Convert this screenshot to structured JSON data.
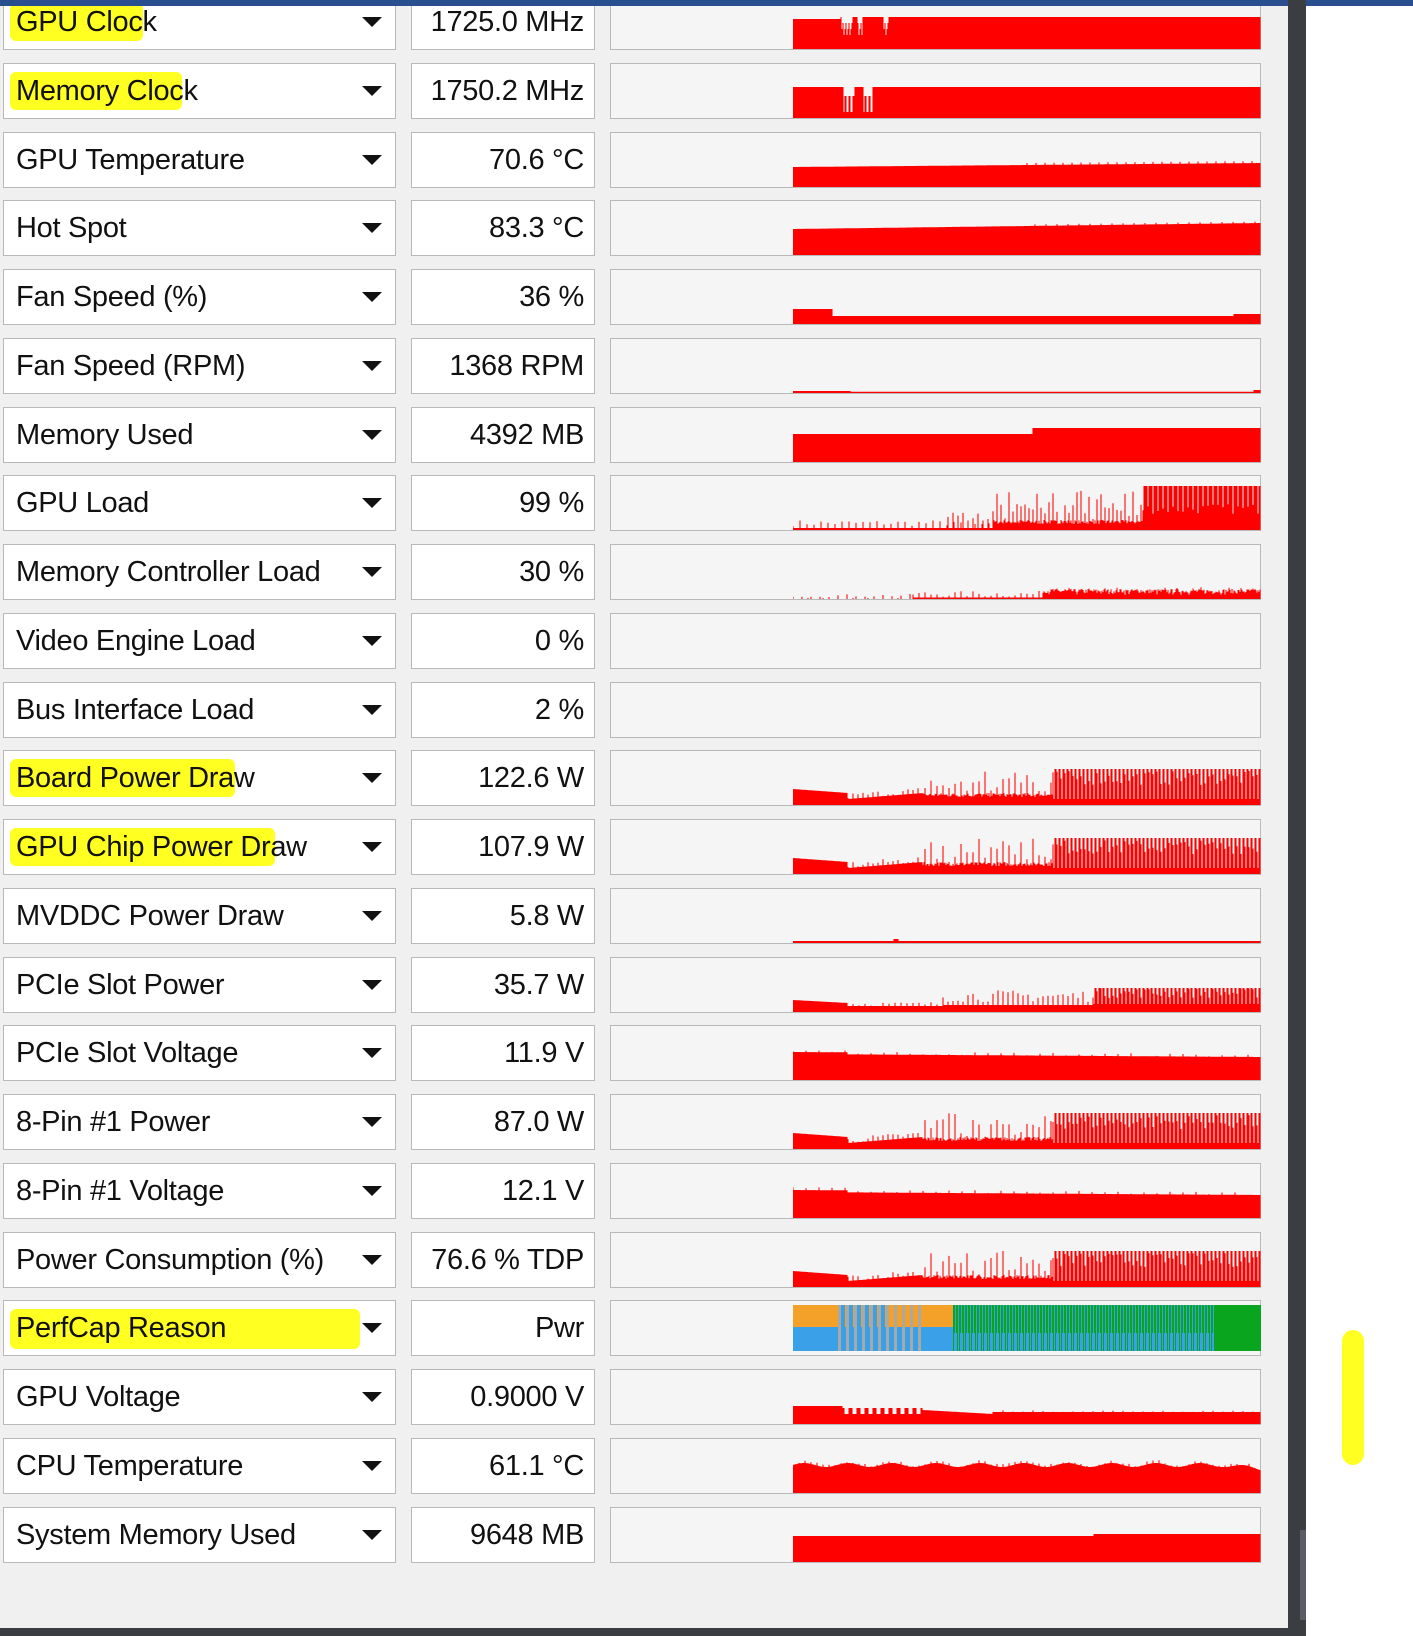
{
  "sensors": [
    {
      "name": "GPU Clock",
      "value": "1725.0 MHz",
      "highlighted": true,
      "graph": "clock"
    },
    {
      "name": "Memory Clock",
      "value": "1750.2 MHz",
      "highlighted": true,
      "graph": "memclock"
    },
    {
      "name": "GPU Temperature",
      "value": "70.6 °C",
      "highlighted": false,
      "graph": "temp"
    },
    {
      "name": "Hot Spot",
      "value": "83.3 °C",
      "highlighted": false,
      "graph": "hotspot"
    },
    {
      "name": "Fan Speed (%)",
      "value": "36 %",
      "highlighted": false,
      "graph": "fan"
    },
    {
      "name": "Fan Speed (RPM)",
      "value": "1368 RPM",
      "highlighted": false,
      "graph": "fanrpm"
    },
    {
      "name": "Memory Used",
      "value": "4392 MB",
      "highlighted": false,
      "graph": "memused"
    },
    {
      "name": "GPU Load",
      "value": "99 %",
      "highlighted": false,
      "graph": "gpuload"
    },
    {
      "name": "Memory Controller Load",
      "value": "30 %",
      "highlighted": false,
      "graph": "mcload"
    },
    {
      "name": "Video Engine Load",
      "value": "0 %",
      "highlighted": false,
      "graph": "none"
    },
    {
      "name": "Bus Interface Load",
      "value": "2 %",
      "highlighted": false,
      "graph": "none"
    },
    {
      "name": "Board Power Draw",
      "value": "122.6 W",
      "highlighted": true,
      "graph": "power"
    },
    {
      "name": "GPU Chip Power Draw",
      "value": "107.9 W",
      "highlighted": true,
      "graph": "power"
    },
    {
      "name": "MVDDC Power Draw",
      "value": "5.8 W",
      "highlighted": false,
      "graph": "thinline"
    },
    {
      "name": "PCIe Slot Power",
      "value": "35.7 W",
      "highlighted": false,
      "graph": "powersmall"
    },
    {
      "name": "PCIe Slot Voltage",
      "value": "11.9 V",
      "highlighted": false,
      "graph": "voltage"
    },
    {
      "name": "8-Pin #1 Power",
      "value": "87.0 W",
      "highlighted": false,
      "graph": "power"
    },
    {
      "name": "8-Pin #1 Voltage",
      "value": "12.1 V",
      "highlighted": false,
      "graph": "voltage"
    },
    {
      "name": "Power Consumption (%)",
      "value": "76.6 % TDP",
      "highlighted": false,
      "graph": "power"
    },
    {
      "name": "PerfCap Reason",
      "value": "Pwr",
      "highlighted": true,
      "graph": "perfcap"
    },
    {
      "name": "GPU Voltage",
      "value": "0.9000 V",
      "highlighted": false,
      "graph": "gpuvolt"
    },
    {
      "name": "CPU Temperature",
      "value": "61.1 °C",
      "highlighted": false,
      "graph": "cputemp"
    },
    {
      "name": "System Memory Used",
      "value": "9648 MB",
      "highlighted": false,
      "graph": "sysmem"
    }
  ],
  "colors": {
    "graph": "#ff0000",
    "highlight": "#ffff22",
    "perfcap_orange": "#f4a12a",
    "perfcap_blue": "#3aa0e8",
    "perfcap_gray": "#a8a8a8",
    "perfcap_green": "#0aa51e"
  },
  "dropdown_icon": "chevron-down-icon"
}
